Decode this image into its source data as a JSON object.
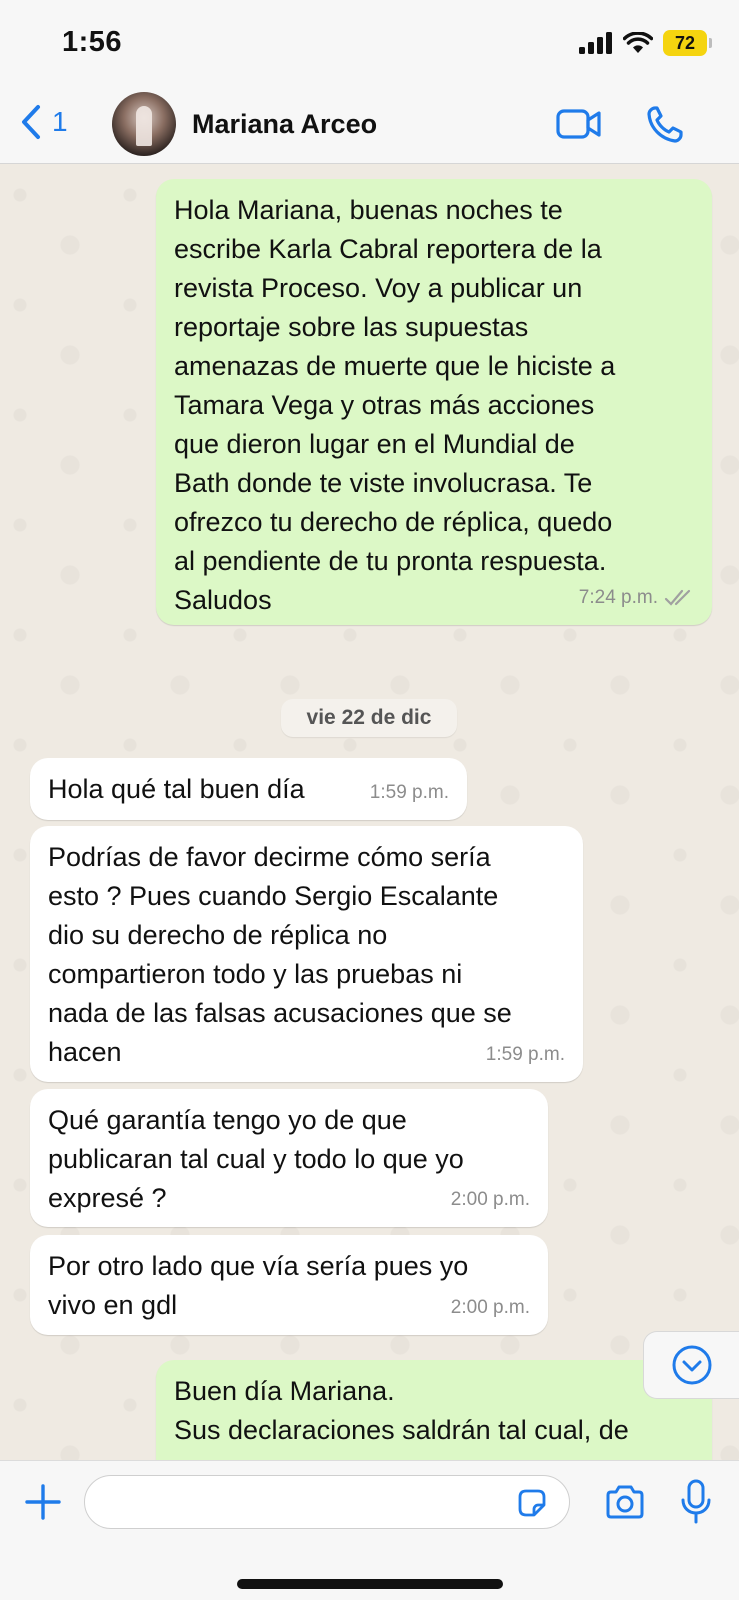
{
  "status_bar": {
    "time": "1:56",
    "battery": "72",
    "icons": [
      "cellular-signal-icon",
      "wifi-icon",
      "battery-icon"
    ]
  },
  "header": {
    "back_count": "1",
    "contact_name": "Mariana Arceo",
    "icons": [
      "chevron-left-icon",
      "video-call-icon",
      "phone-icon"
    ],
    "accent_color": "#1f7bea"
  },
  "messages": [
    {
      "direction": "outgoing",
      "text": "Hola Mariana, buenas noches te\nescribe Karla Cabral reportera de la\nrevista Proceso. Voy a publicar un\nreportaje sobre las supuestas\namenazas de muerte que le hiciste a\nTamara Vega y otras más acciones\nque dieron lugar en el Mundial de\nBath donde te viste involucrasa. Te\nofrezco tu derecho de réplica, quedo\nal pendiente de tu pronta respuesta.\nSaludos",
      "time": "7:24 p.m.",
      "status": "read"
    },
    {
      "direction": "incoming",
      "text": "Hola qué tal buen día",
      "time": "1:59 p.m."
    },
    {
      "direction": "incoming",
      "text": "Podrías de favor decirme cómo sería\nesto ? Pues cuando Sergio Escalante\ndio su derecho de réplica no\ncompartieron todo y las pruebas ni\nnada de las falsas acusaciones que se\nhacen",
      "time": "1:59 p.m."
    },
    {
      "direction": "incoming",
      "text": "Qué garantía tengo yo de que\npublicaran tal cual y todo lo que yo\nexpresé ?",
      "time": "2:00 p.m."
    },
    {
      "direction": "incoming",
      "text": "Por otro lado que vía sería pues yo\nvivo en gdl",
      "time": "2:00 p.m."
    },
    {
      "direction": "outgoing",
      "text": "Buen día Mariana.\nSus declaraciones saldrán tal cual, de",
      "time": ""
    }
  ],
  "date_separator": "vie 22 de dic",
  "input_bar": {
    "placeholder": "",
    "value": "",
    "icons": [
      "plus-icon",
      "sticker-icon",
      "camera-icon",
      "microphone-icon"
    ]
  },
  "colors": {
    "outgoing_bubble": "#dcf8c6",
    "incoming_bubble": "#ffffff",
    "chat_background": "#efeae2",
    "read_ticks": "#a0a0a0"
  }
}
